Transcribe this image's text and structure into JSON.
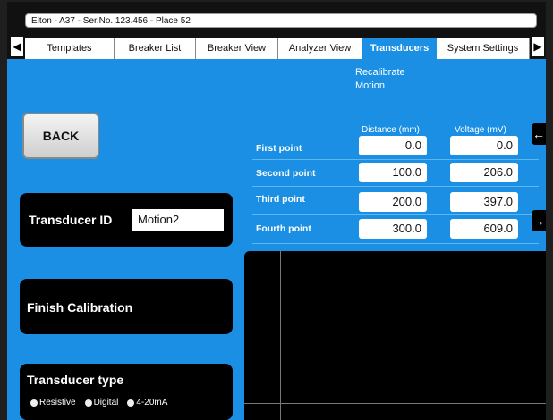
{
  "window": {
    "title": "Elton - A37 - Ser.No. 123.456 - Place 52"
  },
  "tabs": [
    {
      "label": "Templates"
    },
    {
      "label": "Breaker List"
    },
    {
      "label": "Breaker View"
    },
    {
      "label": "Analyzer View"
    },
    {
      "label": "Transducers"
    },
    {
      "label": "System Settings"
    }
  ],
  "nav": {
    "left_arrow": "◀",
    "right_arrow": "▶"
  },
  "subtitle": "Recalibrate Motion",
  "back_label": "BACK",
  "transducer_id": {
    "label": "Transducer ID",
    "value": "Motion2"
  },
  "finish_label": "Finish Calibration",
  "transducer_type": {
    "label": "Transducer type",
    "options": [
      "Resistive",
      "Digital",
      "4-20mA"
    ]
  },
  "table": {
    "headers": {
      "distance": "Distance (mm)",
      "voltage": "Voltage (mV)"
    },
    "rows": [
      {
        "label": "First point",
        "distance": "0.0",
        "voltage": "0.0"
      },
      {
        "label": "Second point",
        "distance": "100.0",
        "voltage": "206.0"
      },
      {
        "label": "Third point",
        "distance": "200.0",
        "voltage": "397.0"
      },
      {
        "label": "Fourth point",
        "distance": "300.0",
        "voltage": "609.0"
      }
    ]
  },
  "side_arrows": {
    "left": "←",
    "right": "→"
  },
  "colors": {
    "background": "#1a8fe3",
    "panel": "#000000"
  }
}
